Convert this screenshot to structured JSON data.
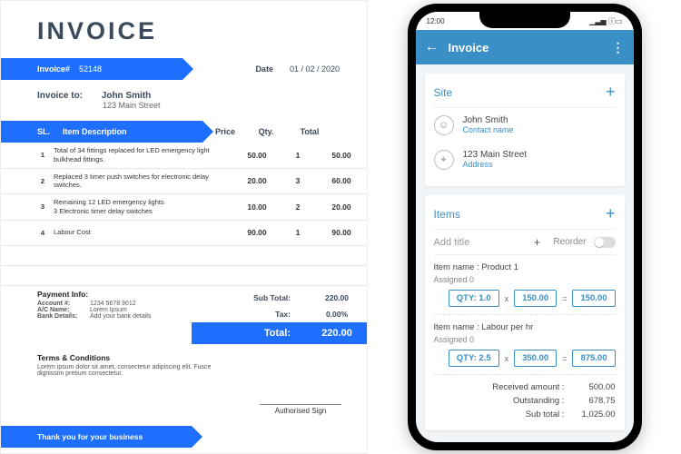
{
  "invoice": {
    "title": "INVOICE",
    "header": {
      "invoice_label": "Invoice#",
      "invoice_number": "52148",
      "date_label": "Date",
      "date_value": "01 / 02 / 2020"
    },
    "to": {
      "label": "Invoice to:",
      "name": "John Smith",
      "address": "123 Main Street"
    },
    "columns": {
      "sl": "SL.",
      "desc": "Item Description",
      "price": "Price",
      "qty": "Qty.",
      "total": "Total"
    },
    "rows": [
      {
        "sl": "1",
        "desc": "Total of 34 fittings replaced for LED emergency light bulkhead fittings.",
        "price": "50.00",
        "qty": "1",
        "total": "50.00"
      },
      {
        "sl": "2",
        "desc": "Replaced 3 timer push switches for electronic delay switches.",
        "price": "20.00",
        "qty": "3",
        "total": "60.00"
      },
      {
        "sl": "3",
        "desc": "Remaining 12 LED emergency lights\n3 Electronic timer delay switches",
        "price": "10.00",
        "qty": "2",
        "total": "20.00"
      },
      {
        "sl": "4",
        "desc": "Labour Cost",
        "price": "90.00",
        "qty": "1",
        "total": "90.00"
      }
    ],
    "payment_info": {
      "heading": "Payment Info:",
      "account_label": "Account #:",
      "account": "1234 5678 9012",
      "ac_name_label": "A/C Name:",
      "ac_name": "Lorem Ipsum",
      "bank_label": "Bank Details:",
      "bank": "Add your bank details"
    },
    "totals": {
      "subtotal_label": "Sub Total:",
      "subtotal": "220.00",
      "tax_label": "Tax:",
      "tax": "0.00%",
      "total_label": "Total:",
      "total": "220.00"
    },
    "terms": {
      "heading": "Terms & Conditions",
      "body": "Lorem ipsum dolor sit amet, consectetur adipiscing elit. Fusce dignissim pretium consectetur."
    },
    "sign_label": "Authorised Sign",
    "thanks": "Thank you for your business"
  },
  "phone": {
    "status": {
      "time": "12:00",
      "battery": "100"
    },
    "appbar": {
      "title": "Invoice"
    },
    "site_card": {
      "heading": "Site",
      "name": "John Smith",
      "name_sub": "Contact name",
      "address": "123 Main Street",
      "address_sub": "Address"
    },
    "items_card": {
      "heading": "Items",
      "add_title_placeholder": "Add title",
      "reorder_label": "Reorder",
      "items": [
        {
          "name_label": "Item name :",
          "name": "Product 1",
          "assigned_label": "Assigned",
          "assigned": "0",
          "qty_label": "QTY:",
          "qty": "1.0",
          "price": "150.00",
          "line_total": "150.00"
        },
        {
          "name_label": "Item name :",
          "name": "Labour per hr",
          "assigned_label": "Assigned",
          "assigned": "0",
          "qty_label": "QTY:",
          "qty": "2.5",
          "price": "350.00",
          "line_total": "875.00"
        }
      ],
      "summary": {
        "received_label": "Received amount :",
        "received": "500.00",
        "outstanding_label": "Outstanding :",
        "outstanding": "678.75",
        "subtotal_label": "Sub total :",
        "subtotal": "1,025.00"
      }
    }
  }
}
